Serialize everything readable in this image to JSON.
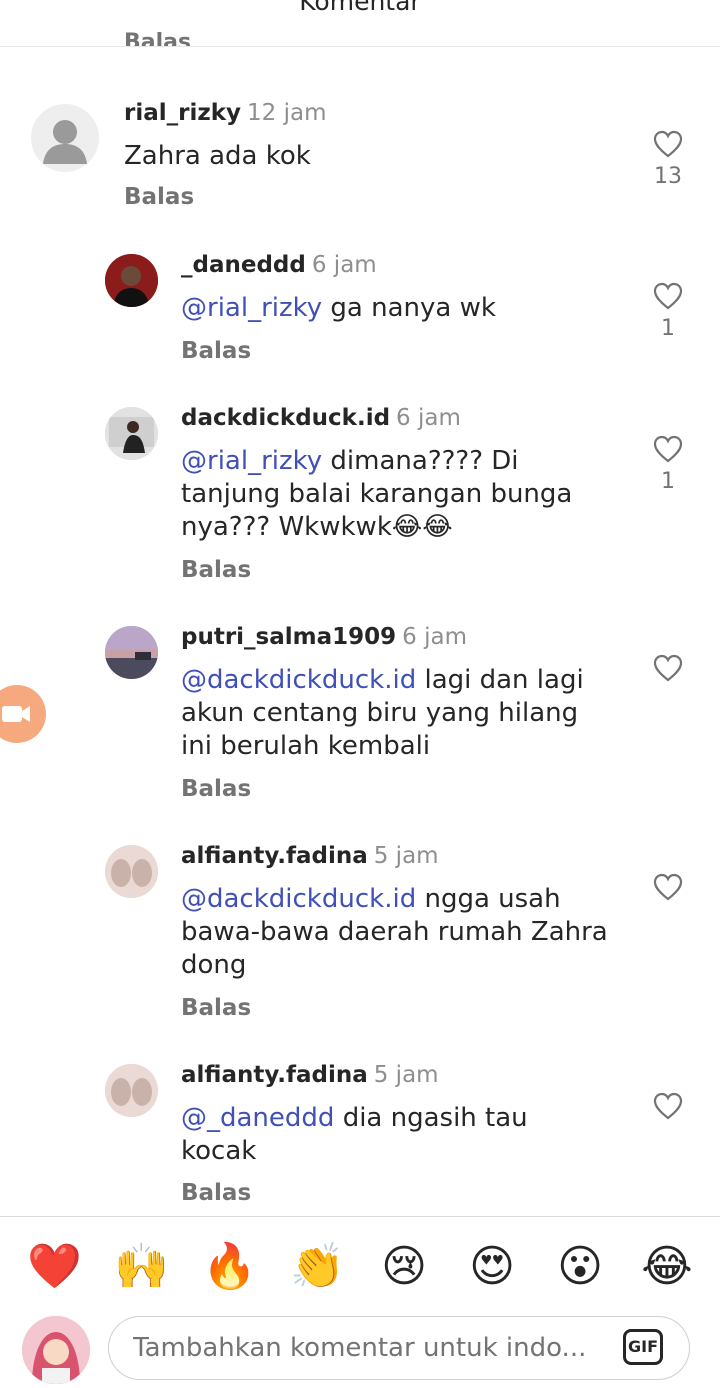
{
  "header": {
    "title": "Komentar",
    "partial_reply": "Balas"
  },
  "comments": [
    {
      "username": "rial_rizky",
      "time": "12 jam",
      "mention": "",
      "text": "Zahra ada kok",
      "reply": "Balas",
      "likes": "13"
    },
    {
      "username": "_daneddd",
      "time": "6 jam",
      "mention": "@rial_rizky",
      "text": " ga nanya wk",
      "reply": "Balas",
      "likes": "1"
    },
    {
      "username": "dackdickduck.id",
      "time": "6 jam",
      "mention": "@rial_rizky",
      "text": " dimana???? Di tanjung balai karangan bunga nya??? Wkwkwk😂😂",
      "reply": "Balas",
      "likes": "1"
    },
    {
      "username": "putri_salma1909",
      "time": "6 jam",
      "mention": "@dackdickduck.id",
      "text": " lagi dan lagi akun centang biru yang hilang ini berulah kembali",
      "reply": "Balas",
      "likes": ""
    },
    {
      "username": "alfianty.fadina",
      "time": "5 jam",
      "mention": "@dackdickduck.id",
      "text": " ngga usah bawa-bawa daerah rumah Zahra dong",
      "reply": "Balas",
      "likes": ""
    },
    {
      "username": "alfianty.fadina",
      "time": "5 jam",
      "mention": "@_daneddd",
      "text": " dia ngasih tau kocak",
      "reply": "Balas",
      "likes": ""
    }
  ],
  "emoji_bar": [
    "❤️",
    "🙌",
    "🔥",
    "👏",
    "😢",
    "😍",
    "😮",
    "😂"
  ],
  "composer": {
    "placeholder": "Tambahkan komentar untuk indo...",
    "gif_label": "GIF"
  },
  "icons": {
    "like": "heart-outline-icon",
    "gif": "gif-icon",
    "camera": "video-camera-icon"
  },
  "colors": {
    "mention": "#4150b8",
    "secondary_text": "#737373",
    "floating_button": "#f6a97f"
  }
}
